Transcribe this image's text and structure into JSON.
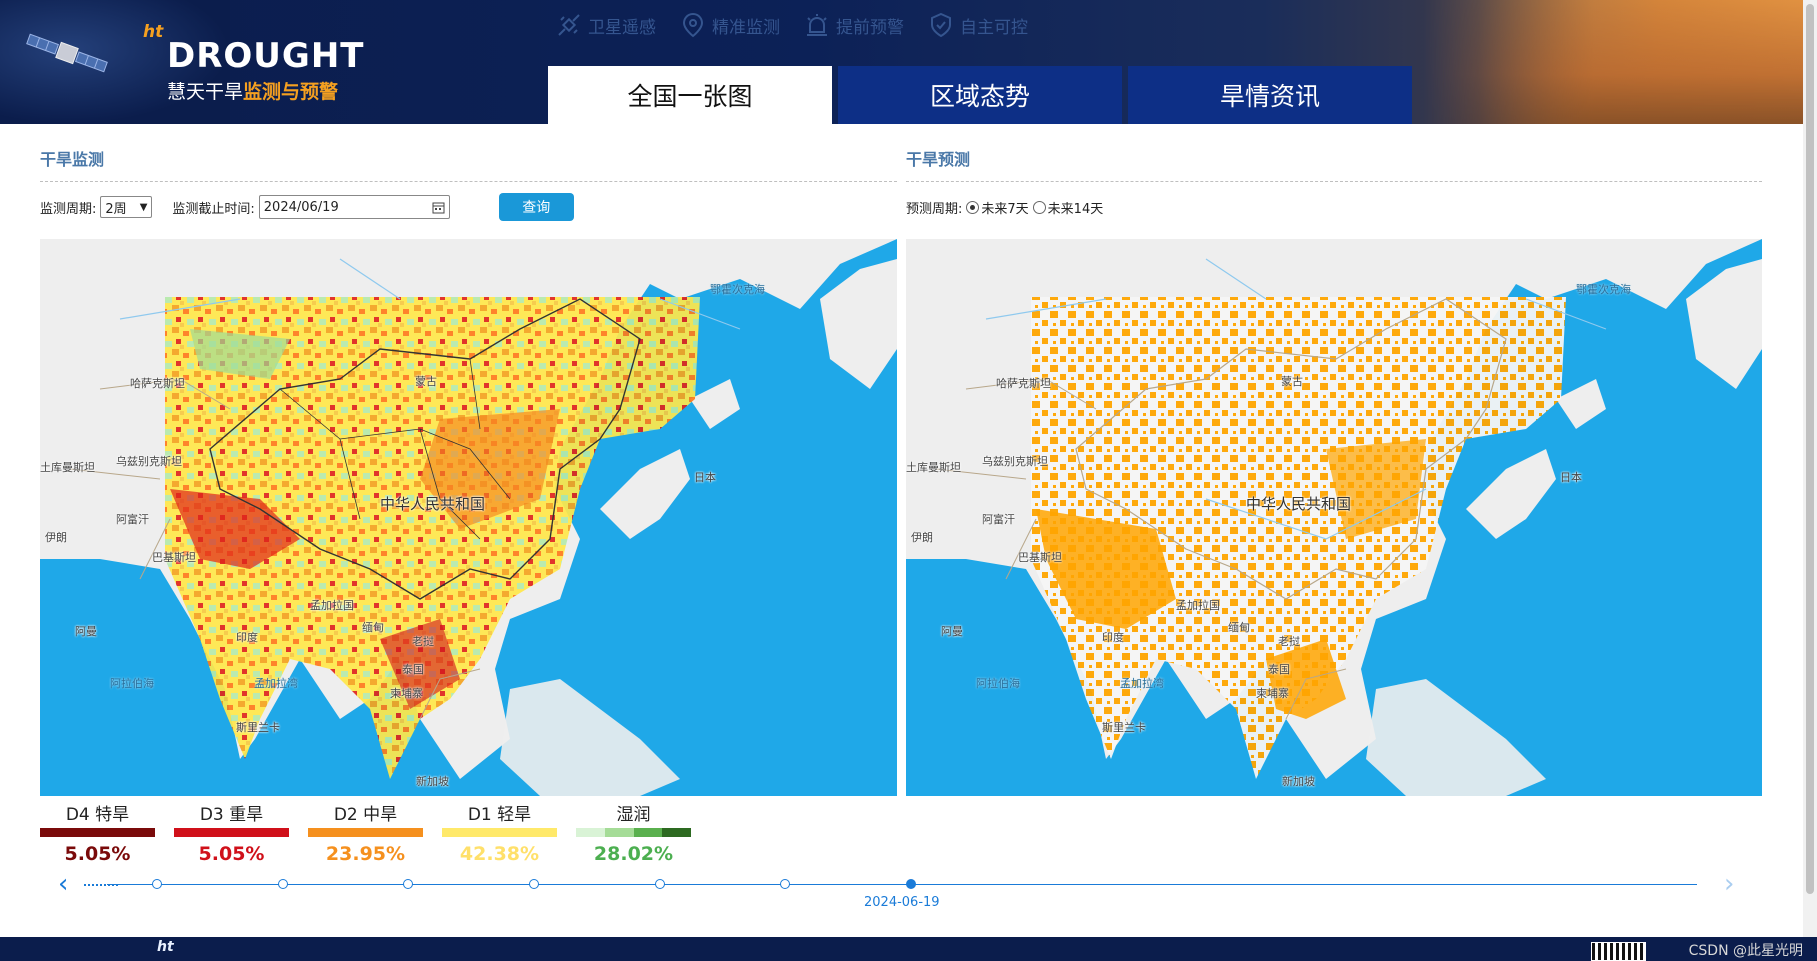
{
  "header": {
    "logo_prefix": "ht",
    "logo_brand": "DROUGHT",
    "logo_sub_plain": "慧天干旱",
    "logo_sub_accent": "监测与预警",
    "features": [
      {
        "label": "卫星遥感",
        "icon": "satellite-icon"
      },
      {
        "label": "精准监测",
        "icon": "location-pin-icon"
      },
      {
        "label": "提前预警",
        "icon": "alarm-icon"
      },
      {
        "label": "自主可控",
        "icon": "shield-icon"
      }
    ],
    "tabs": [
      {
        "label": "全国一张图",
        "active": true
      },
      {
        "label": "区域态势",
        "active": false
      },
      {
        "label": "旱情资讯",
        "active": false
      }
    ]
  },
  "monitor": {
    "title": "干旱监测",
    "period_label": "监测周期:",
    "period_value": "2周",
    "date_label": "监测截止时间:",
    "date_value": "2024/06/19",
    "query_button": "查询"
  },
  "forecast": {
    "title": "干旱预测",
    "period_label": "预测周期:",
    "options": [
      {
        "label": "未来7天",
        "checked": true
      },
      {
        "label": "未来14天",
        "checked": false
      }
    ]
  },
  "map_labels": {
    "china": "中华人民共和国",
    "mongolia": "蒙古",
    "kazakhstan": "哈萨克斯坦",
    "uzbekistan": "乌兹别克斯坦",
    "turkmenistan": "土库曼斯坦",
    "afghanistan": "阿富汗",
    "iran": "伊朗",
    "pakistan": "巴基斯坦",
    "india": "印度",
    "bangladesh": "孟加拉国",
    "myanmar": "缅甸",
    "laos": "老挝",
    "thailand": "泰国",
    "cambodia": "柬埔寨",
    "sri_lanka": "斯里兰卡",
    "oman": "阿曼",
    "japan": "日本",
    "singapore": "新加坡",
    "okhotsk": "鄂霍次克海",
    "arabian_sea": "阿拉伯海",
    "bay_of_bengal": "孟加拉湾"
  },
  "legend": [
    {
      "name": "D4 特旱",
      "pct": "5.05%",
      "color": "#7a0a0a"
    },
    {
      "name": "D3 重旱",
      "pct": "5.05%",
      "color": "#d0101a"
    },
    {
      "name": "D2 中旱",
      "pct": "23.95%",
      "color": "#f5901e"
    },
    {
      "name": "D1 轻旱",
      "pct": "42.38%",
      "color": "#ffe96a"
    },
    {
      "name": "湿润",
      "pct": "28.02%",
      "color": "#4caf50",
      "wet_colors": [
        "#d9f3d6",
        "#a5dc97",
        "#5ab04e",
        "#2d6a21"
      ]
    }
  ],
  "timeline": {
    "current_date": "2024-06-19",
    "node_count": 7
  },
  "footer": {
    "logo_prefix": "ht",
    "watermark": "CSDN @此星光明"
  }
}
